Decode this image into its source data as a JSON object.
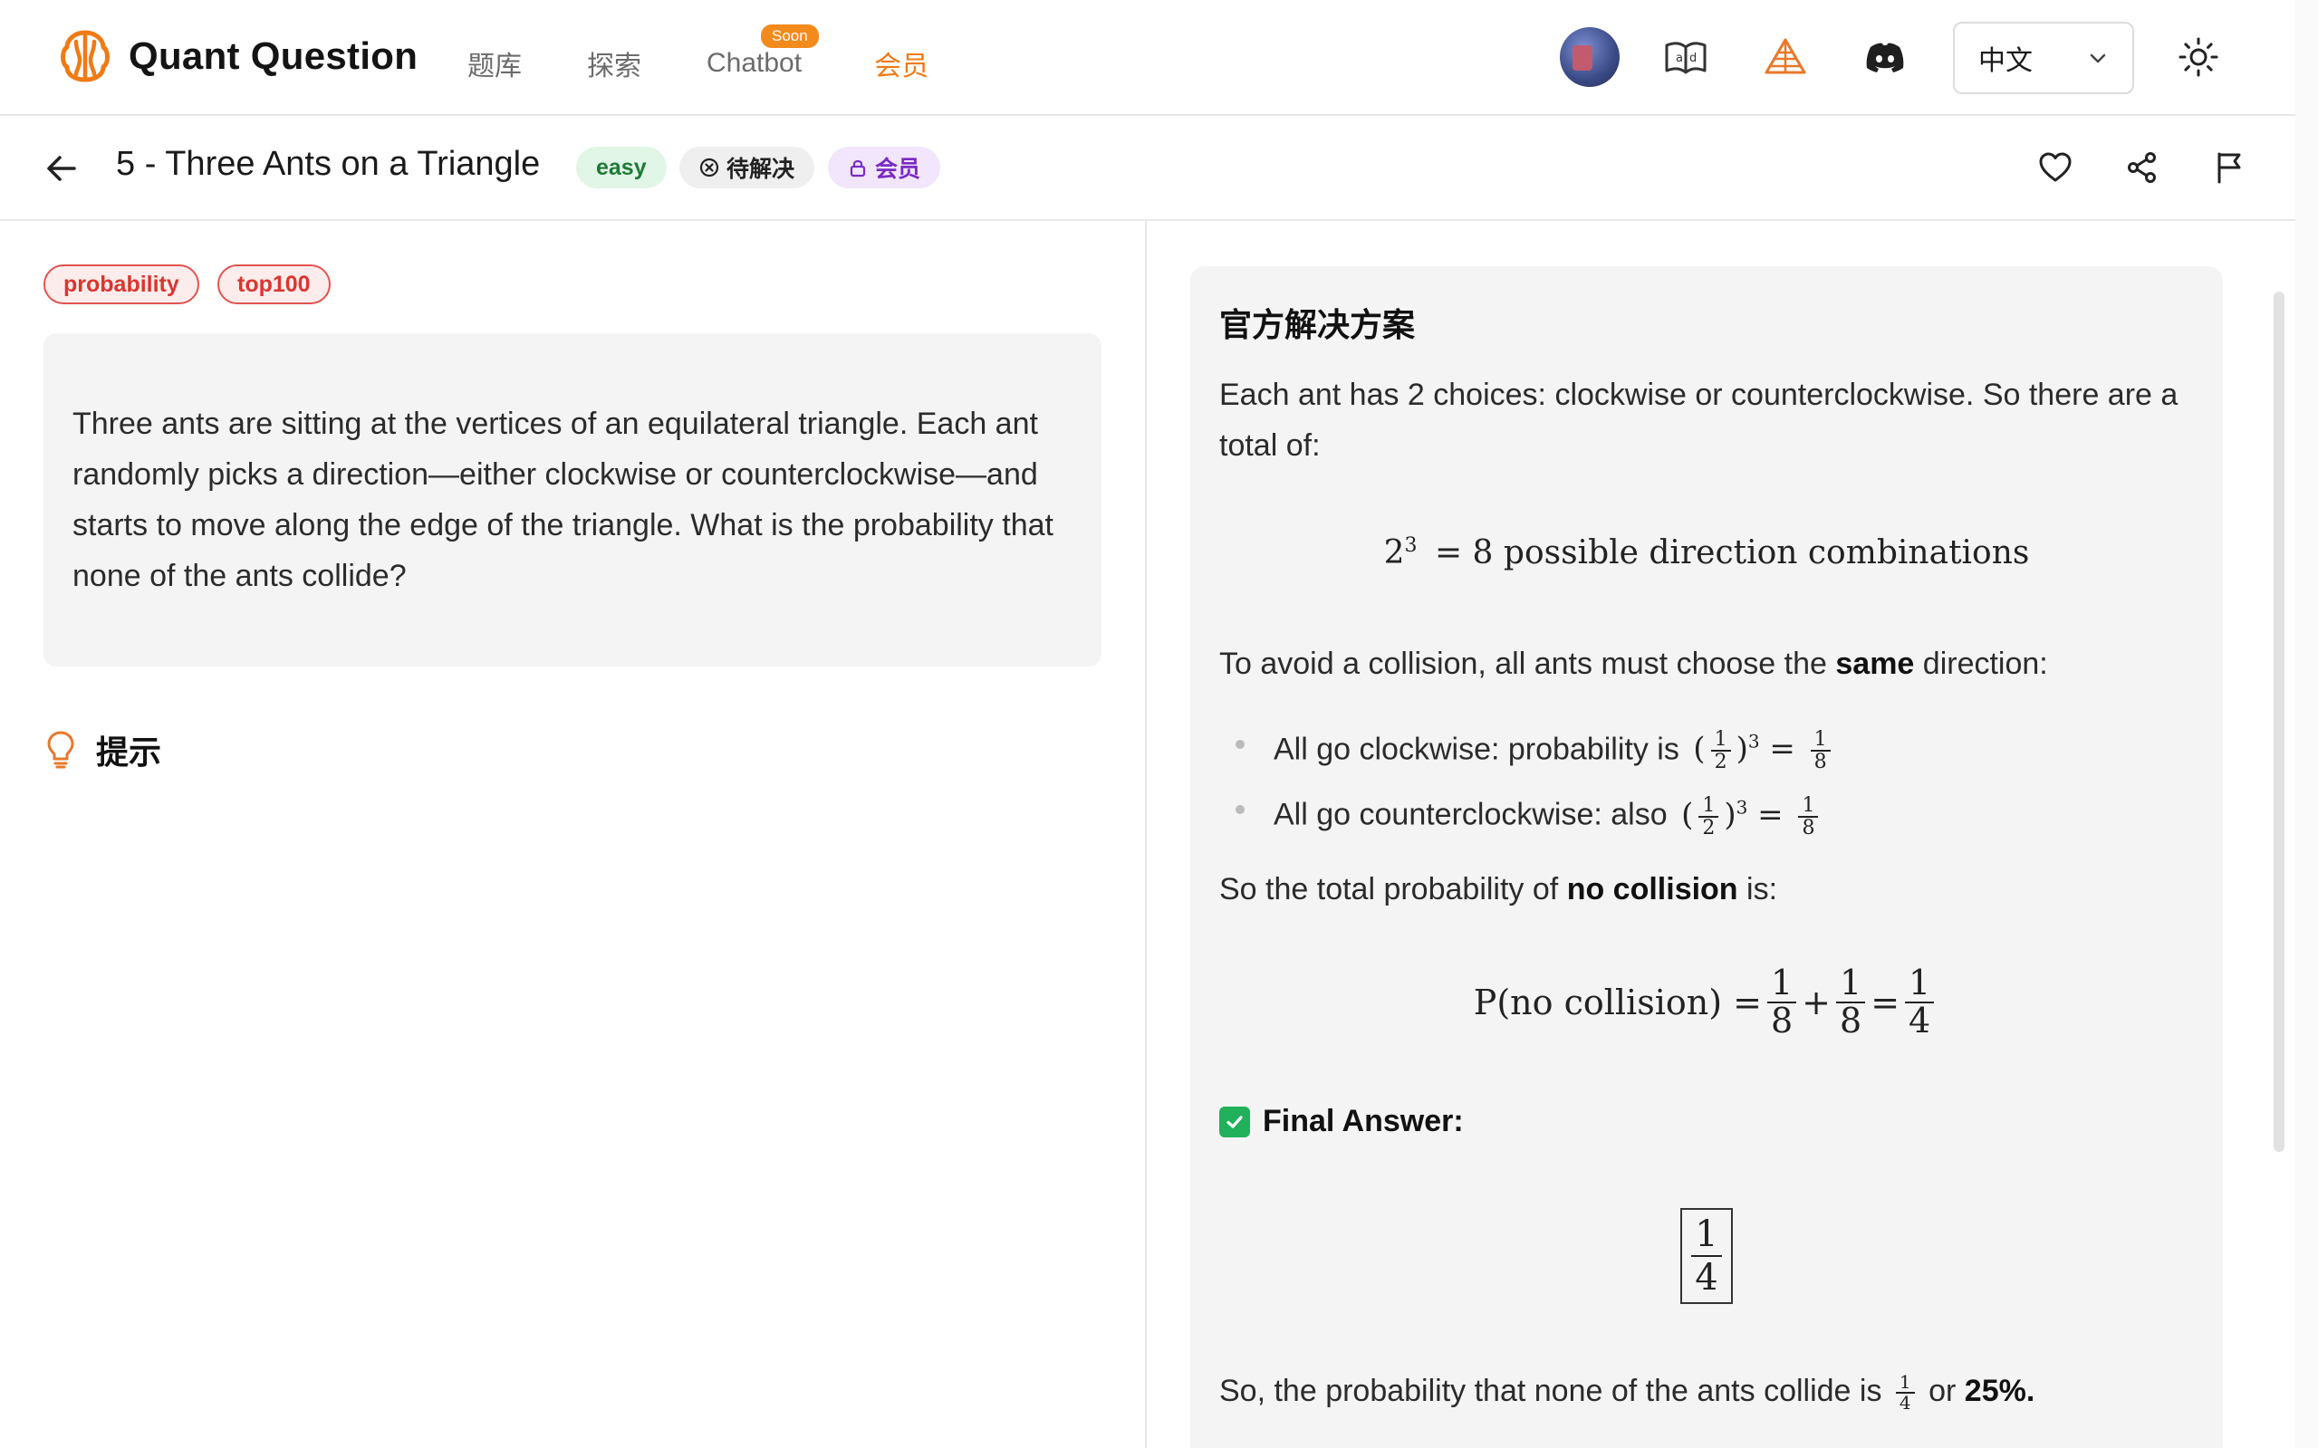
{
  "brand": {
    "name": "Quant Question"
  },
  "nav": {
    "items": [
      {
        "label": "题库",
        "active": false
      },
      {
        "label": "探索",
        "active": false
      },
      {
        "label": "Chatbot",
        "active": false,
        "badge": "Soon"
      },
      {
        "label": "会员",
        "active": true
      }
    ]
  },
  "language": {
    "selected": "中文"
  },
  "question": {
    "title": "5 - Three Ants on a Triangle",
    "difficulty": "easy",
    "status": "待解决",
    "access": "会员",
    "tags": [
      "probability",
      "top100"
    ],
    "text": "Three ants are sitting at the vertices of an equilateral triangle. Each ant randomly picks a direction—either clockwise or counterclockwise—and starts to move along the edge of the triangle. What is the probability that none of the ants collide?"
  },
  "hint": {
    "label": "提示"
  },
  "solution": {
    "title": "官方解决方案",
    "intro": "Each ant has 2 choices: clockwise or counterclockwise. So there are a total of:",
    "eq1": {
      "base": "2",
      "exp": "3",
      "rest": "= 8 possible direction combinations"
    },
    "avoid_pre": "To avoid a collision, all ants must choose the ",
    "avoid_bold": "same",
    "avoid_post": " direction:",
    "bullets": [
      {
        "text": "All go clockwise: probability is"
      },
      {
        "text": "All go counterclockwise: also"
      }
    ],
    "total_pre": "So the total probability of ",
    "total_bold": "no collision",
    "total_post": " is:",
    "eq2_lhs": "P(no collision) =",
    "final_label": "Final Answer:",
    "answer": {
      "num": "1",
      "den": "4"
    },
    "closing_pre": "So, the probability that none of the ants collide is",
    "closing_mid": "or",
    "closing_bold": "25%."
  },
  "colors": {
    "accent": "#f07a14",
    "tag_red": "#d9362f",
    "easy_green": "#1e7a37",
    "member_purple": "#7a2bc4"
  }
}
